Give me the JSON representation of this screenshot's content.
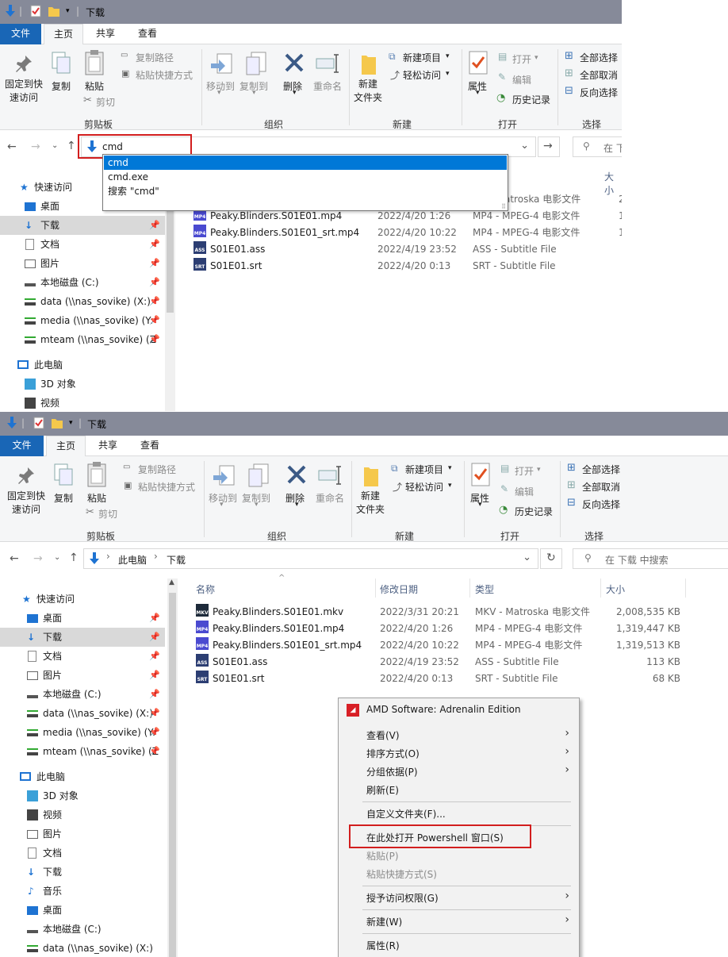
{
  "colors": {
    "accent": "#1966b6",
    "title_bar": "#868a99",
    "highlight_box": "#d21e1e",
    "selection": "#0078d7"
  },
  "title": "下载",
  "menu_tabs": [
    "文件",
    "主页",
    "共享",
    "查看"
  ],
  "ribbon": {
    "pin_quick_access": [
      "固定到快",
      "速访问"
    ],
    "copy": "复制",
    "paste": "粘贴",
    "copy_path": "复制路径",
    "paste_shortcut": "粘贴快捷方式",
    "cut": "剪切",
    "clipboard_group": "剪贴板",
    "move_to": "移动到",
    "copy_to": "复制到",
    "delete": "删除",
    "rename": "重命名",
    "organize_group": "组织",
    "new_folder": [
      "新建",
      "文件夹"
    ],
    "new_item": "新建项目",
    "easy_access": "轻松访问",
    "new_group": "新建",
    "properties": "属性",
    "open": "打开",
    "edit": "编辑",
    "history": "历史记录",
    "open_group": "打开",
    "select_all": "全部选择",
    "select_none": "全部取消",
    "invert_selection": "反向选择",
    "select_group": "选择"
  },
  "screenshot1": {
    "address_value": "cmd",
    "search_placeholder": "在 下",
    "size_header_partial": "大小",
    "autocomplete": [
      "cmd",
      "cmd.exe",
      "搜索 \"cmd\""
    ],
    "partial_type": "atroska 电影文件",
    "partial_sizes": [
      "2",
      "1",
      "1"
    ]
  },
  "screenshot2": {
    "breadcrumb": [
      "此电脑",
      "下载"
    ],
    "search_placeholder": "在 下载 中搜索",
    "columns": [
      "名称",
      "修改日期",
      "类型",
      "大小"
    ]
  },
  "nav_pane": {
    "quick_access": "快速访问",
    "pinned": [
      "桌面",
      "下载",
      "文档",
      "图片",
      "本地磁盘 (C:)",
      "data (\\\\nas_sovike) (X:)",
      "media (\\\\nas_sovike) (Y:",
      "mteam (\\\\nas_sovike) (Z"
    ],
    "this_pc": "此电脑",
    "pc_items_1": [
      "3D 对象",
      "视频"
    ],
    "pc_items_2": [
      "3D 对象",
      "视频",
      "图片",
      "文档",
      "下载",
      "音乐",
      "桌面",
      "本地磁盘 (C:)",
      "data (\\\\nas_sovike) (X:)"
    ]
  },
  "files": [
    {
      "name": "Peaky.Blinders.S01E01.mkv",
      "date": "2022/3/31 20:21",
      "type": "MKV - Matroska 电影文件",
      "size": "2,008,535 KB",
      "badge": "MKV"
    },
    {
      "name": "Peaky.Blinders.S01E01.mp4",
      "date": "2022/4/20 1:26",
      "type": "MP4 - MPEG-4 电影文件",
      "size": "1,319,447 KB",
      "badge": "MP4"
    },
    {
      "name": "Peaky.Blinders.S01E01_srt.mp4",
      "date": "2022/4/20 10:22",
      "type": "MP4 - MPEG-4 电影文件",
      "size": "1,319,513 KB",
      "badge": "MP4"
    },
    {
      "name": "S01E01.ass",
      "date": "2022/4/19 23:52",
      "type": "ASS - Subtitle File",
      "size": "113 KB",
      "badge": "ASS"
    },
    {
      "name": "S01E01.srt",
      "date": "2022/4/20 0:13",
      "type": "SRT - Subtitle File",
      "size": "68 KB",
      "badge": "SRT"
    }
  ],
  "context_menu": {
    "amd": "AMD Software: Adrenalin Edition",
    "view": "查看(V)",
    "sort": "排序方式(O)",
    "group": "分组依据(P)",
    "refresh": "刷新(E)",
    "customize": "自定义文件夹(F)...",
    "powershell": "在此处打开 Powershell 窗口(S)",
    "paste": "粘贴(P)",
    "paste_shortcut": "粘贴快捷方式(S)",
    "grant_access": "授予访问权限(G)",
    "new": "新建(W)",
    "properties": "属性(R)"
  }
}
